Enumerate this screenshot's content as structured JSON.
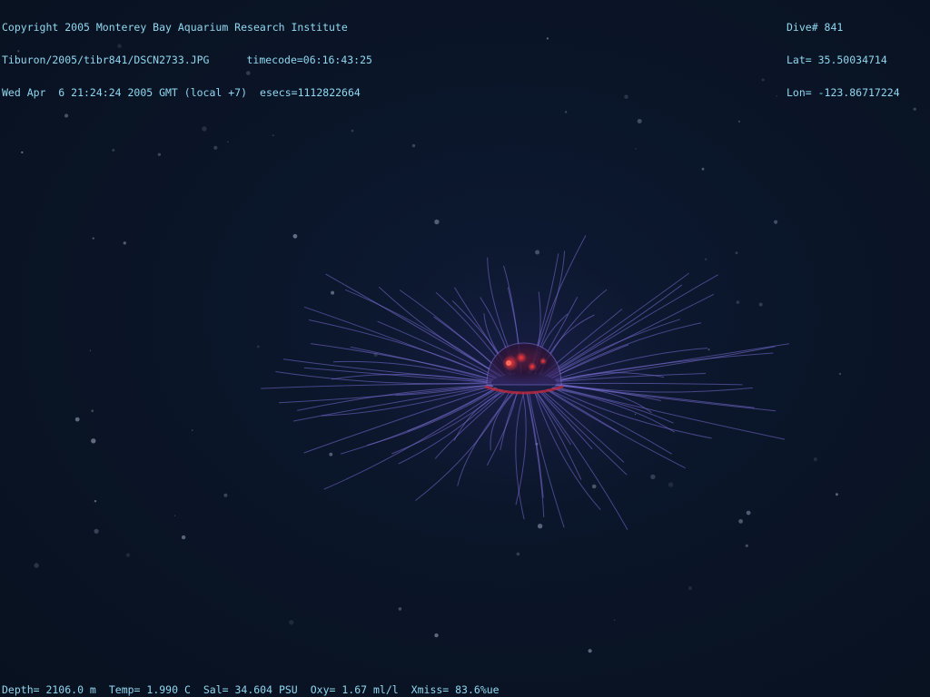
{
  "overlay": {
    "top_left": {
      "line1": "Copyright 2005 Monterey Bay Aquarium Research Institute",
      "line2_file": "Tiburon/2005/tibr841/DSCN2733.JPG",
      "line2_timecode": "timecode=06:16:43:25",
      "line3_date": "Wed Apr  6 21:24:24 2005 GMT (local +7)",
      "line3_esecs": "esecs=1112822664"
    },
    "top_right": {
      "dive": "Dive# 841",
      "lat": "Lat= 35.50034714",
      "lon": "Lon= -123.86717224"
    },
    "bottom": {
      "depth": "Depth= 2106.0 m",
      "temp": "Temp= 1.990 C",
      "sal": "Sal= 34.604 PSU",
      "oxy": "Oxy= 1.67 ml/l",
      "xmiss": "Xmiss= 83.6%ue"
    }
  },
  "colors": {
    "background": "#0a1426",
    "overlay_text": "#8fd8f0",
    "tentacle": "#7a6fd6",
    "bell_red": "#c0283a"
  },
  "subject_icon": "jellyfish-icon"
}
